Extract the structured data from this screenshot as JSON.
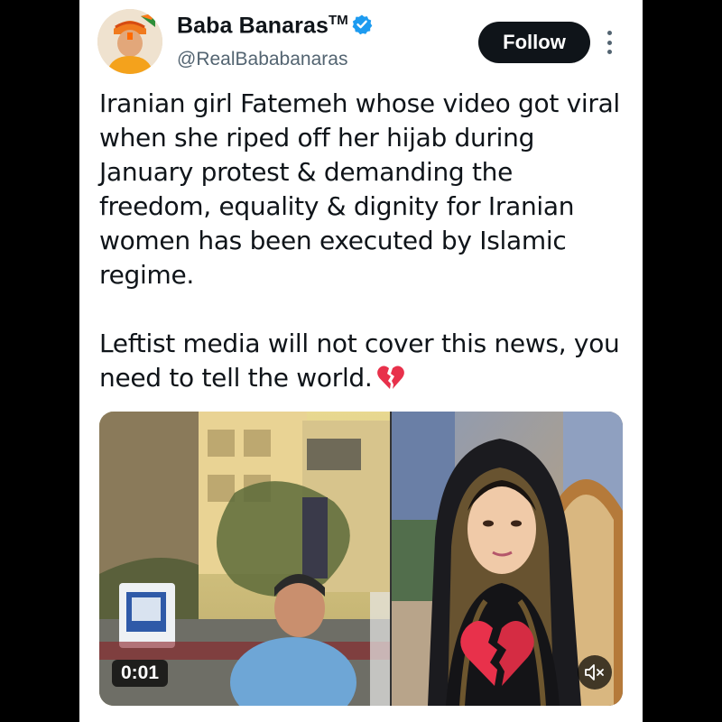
{
  "author": {
    "display_name": "Baba Banaras",
    "trademark": "TM",
    "handle": "@RealBababanaras",
    "verified_icon": "verified-badge-icon",
    "verified_color": "#1d9bf0"
  },
  "actions": {
    "follow_label": "Follow",
    "more_icon": "more-vertical-icon"
  },
  "tweet": {
    "paragraph_1": "Iranian girl Fatemeh whose video got viral when she riped off her hijab during January protest & demanding the freedom, equality & dignity for Iranian women has been executed by Islamic regime.",
    "paragraph_2": "Leftist media will not cover this news, you need to tell the world.",
    "emoji": "broken-heart-icon"
  },
  "media": {
    "timestamp": "0:01",
    "mute_icon": "volume-muted-icon",
    "overlay_icon": "broken-heart-icon"
  },
  "colors": {
    "text_primary": "#0f1419",
    "text_secondary": "#536471",
    "follow_bg": "#0f1419",
    "broken_heart": "#e8314b"
  }
}
